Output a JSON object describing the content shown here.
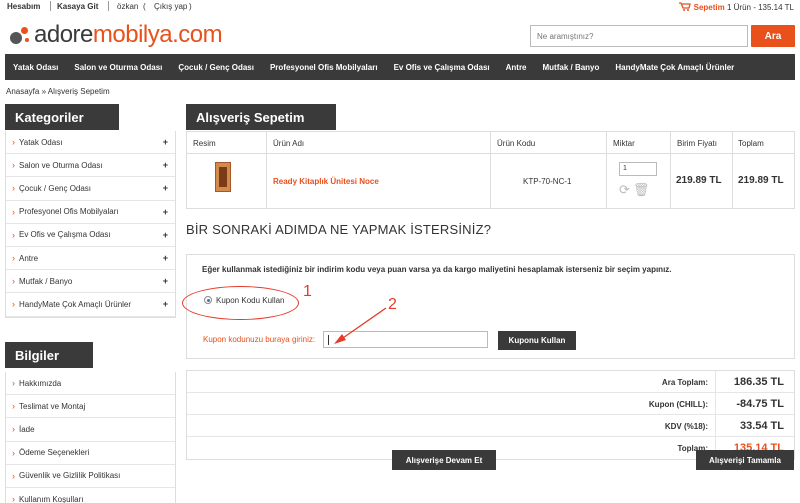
{
  "topbar": {
    "account": "Hesabım",
    "checkout": "Kasaya Git",
    "user": "özkan",
    "paren_open": "(",
    "logout": "Çıkış yap",
    "paren_close": ")",
    "cart_label": "Sepetim",
    "cart_summary": "1 Ürün - 135.14 TL"
  },
  "logo": {
    "part1": "adore",
    "part2": "mobilya.com"
  },
  "search": {
    "placeholder": "Ne aramıştınız?",
    "button": "Ara"
  },
  "nav": [
    "Yatak Odası",
    "Salon ve Oturma Odası",
    "Çocuk / Genç Odası",
    "Profesyonel Ofis Mobilyaları",
    "Ev Ofis ve Çalışma Odası",
    "Antre",
    "Mutfak / Banyo",
    "HandyMate Çok Amaçlı Ürünler"
  ],
  "breadcrumb": "Anasayfa » Alışveriş Sepetim",
  "categories": {
    "title": "Kategoriler",
    "items": [
      "Yatak Odası",
      "Salon ve Oturma Odası",
      "Çocuk / Genç Odası",
      "Profesyonel Ofis Mobilyaları",
      "Ev Ofis ve Çalışma Odası",
      "Antre",
      "Mutfak / Banyo",
      "HandyMate Çok Amaçlı Ürünler"
    ]
  },
  "info": {
    "title": "Bilgiler",
    "items": [
      "Hakkımızda",
      "Teslimat ve Montaj",
      "İade",
      "Ödeme Seçenekleri",
      "Güvenlik ve Gizlilik Politikası",
      "Kullanım Koşulları"
    ]
  },
  "cart": {
    "title": "Alışveriş Sepetim",
    "headers": {
      "image": "Resim",
      "name": "Ürün Adı",
      "code": "Ürün Kodu",
      "qty": "Miktar",
      "unit": "Birim Fiyatı",
      "total": "Toplam"
    },
    "item": {
      "name": "Ready Kitaplık Ünitesi Noce",
      "code": "KTP-70-NC-1",
      "qty": "1",
      "unit_price": "219.89 TL",
      "total": "219.89 TL"
    }
  },
  "next_step": {
    "heading": "BİR SONRAKİ ADIMDA NE YAPMAK İSTERSİNİZ?",
    "description": "Eğer kullanmak istediğiniz bir indirim kodu veya puan varsa ya da kargo maliyetini hesaplamak isterseniz bir seçim yapınız.",
    "radio_label": "Kupon Kodu Kullan",
    "coupon_label": "Kupon kodunuzu buraya giriniz:",
    "coupon_button": "Kuponu Kullan"
  },
  "annotations": {
    "one": "1",
    "two": "2"
  },
  "totals": [
    {
      "label": "Ara Toplam:",
      "value": "186.35 TL"
    },
    {
      "label": "Kupon (CHILL):",
      "value": "-84.75 TL"
    },
    {
      "label": "KDV (%18):",
      "value": "33.54 TL"
    },
    {
      "label": "Toplam:",
      "value": "135.14 TL"
    }
  ],
  "buttons": {
    "continue": "Alışverişe Devam Et",
    "checkout": "Alışverişi Tamamla"
  },
  "colors": {
    "accent": "#e8501c",
    "dark": "#3a3a3a",
    "annotation": "#e53b2c"
  }
}
